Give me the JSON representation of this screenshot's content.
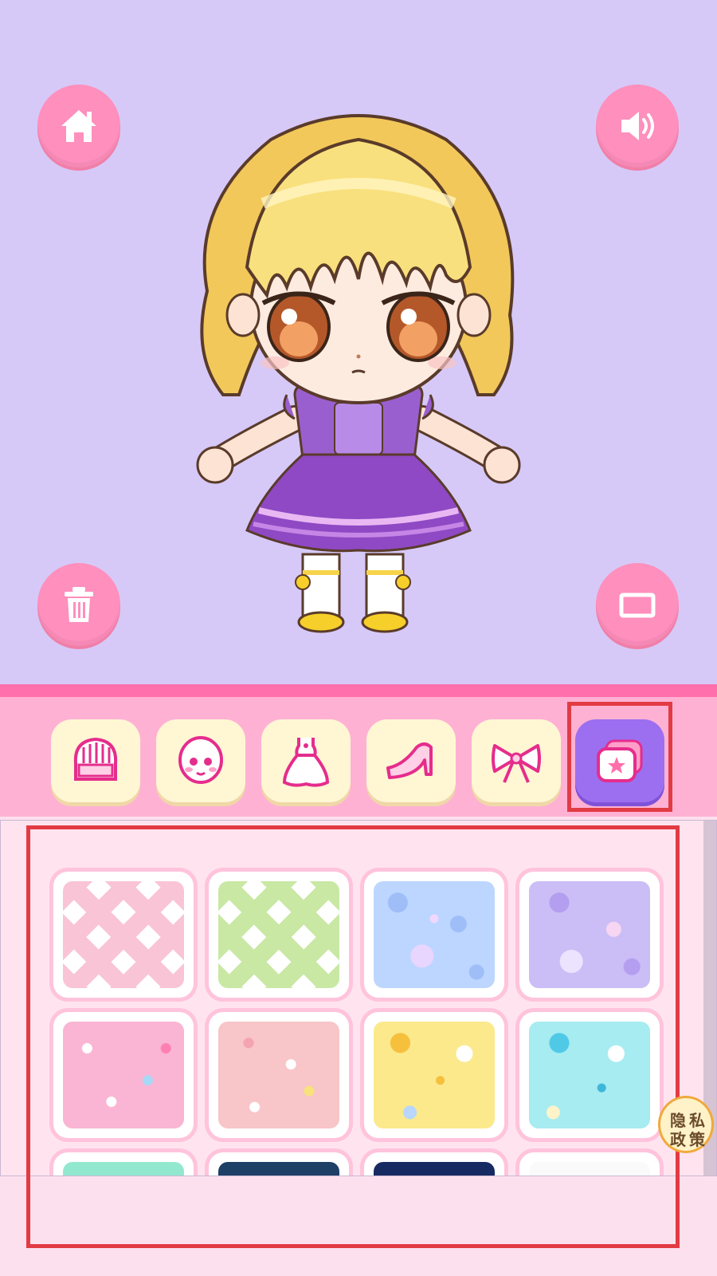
{
  "stage": {
    "background": "#d6c9f8",
    "buttons": [
      {
        "name": "home-button",
        "icon": "home-icon"
      },
      {
        "name": "sound-button",
        "icon": "speaker-icon"
      },
      {
        "name": "delete-button",
        "icon": "trash-icon"
      },
      {
        "name": "fullscreen-button",
        "icon": "rectangle-icon"
      }
    ]
  },
  "tabs": [
    {
      "name": "tab-hair",
      "icon": "hair-icon",
      "active": false
    },
    {
      "name": "tab-face",
      "icon": "face-icon",
      "active": false
    },
    {
      "name": "tab-dress",
      "icon": "dress-icon",
      "active": false
    },
    {
      "name": "tab-shoes",
      "icon": "high-heel-icon",
      "active": false
    },
    {
      "name": "tab-accessory",
      "icon": "bow-icon",
      "active": false
    },
    {
      "name": "tab-background",
      "icon": "photo-star-icon",
      "active": true
    }
  ],
  "backgrounds": [
    {
      "name": "pink-plaid",
      "base": "#fde1ea"
    },
    {
      "name": "green-plaid",
      "base": "#dff3c9"
    },
    {
      "name": "blue-dots",
      "base": "#bcd6ff"
    },
    {
      "name": "purple-dots",
      "base": "#cbbdf5"
    },
    {
      "name": "pink-hearts",
      "base": "#f9b5d3"
    },
    {
      "name": "peach-hearts",
      "base": "#f8c5c8"
    },
    {
      "name": "yellow-stars",
      "base": "#fbe98c"
    },
    {
      "name": "cyan-stars",
      "base": "#a6ecf1"
    },
    {
      "name": "mint-sprinkles",
      "base": "#92e8cf"
    },
    {
      "name": "navy-sprinkles",
      "base": "#1e3f66"
    },
    {
      "name": "night-sky",
      "base": "#182a62"
    },
    {
      "name": "white-leaves",
      "base": "#fafafa"
    }
  ],
  "privacy_badge": {
    "text_a": "隐",
    "text_b": "私",
    "text_c": "政",
    "text_d": "策"
  },
  "colors": {
    "accent": "#ff8fbd",
    "tab_active": "#9c6ff0",
    "highlight": "#e23b43"
  }
}
